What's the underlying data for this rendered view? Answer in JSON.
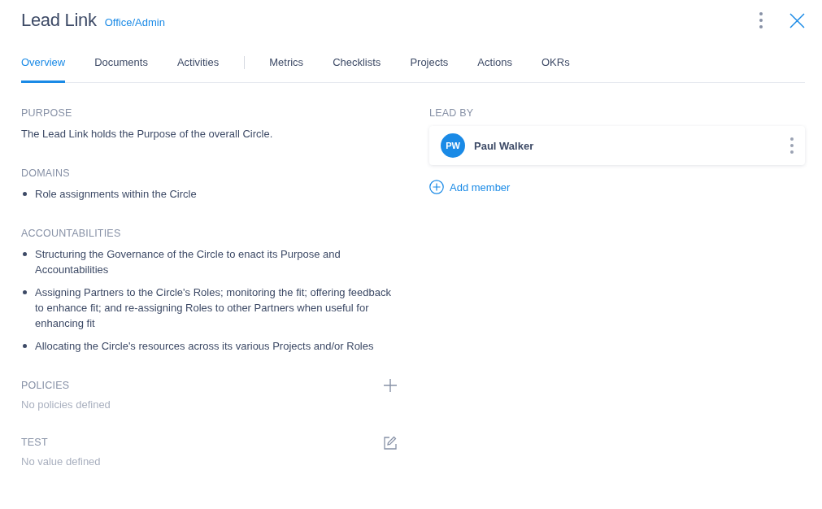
{
  "header": {
    "title": "Lead Link",
    "subtitle": "Office/Admin"
  },
  "tab_groups": [
    {
      "tabs": [
        {
          "label": "Overview",
          "selected": true
        },
        {
          "label": "Documents",
          "selected": false
        },
        {
          "label": "Activities",
          "selected": false
        }
      ]
    },
    {
      "tabs": [
        {
          "label": "Metrics",
          "selected": false
        },
        {
          "label": "Checklists",
          "selected": false
        },
        {
          "label": "Projects",
          "selected": false
        },
        {
          "label": "Actions",
          "selected": false
        },
        {
          "label": "OKRs",
          "selected": false
        }
      ]
    }
  ],
  "sections": [
    {
      "kind": "text",
      "heading": "PURPOSE",
      "text": "The Lead Link holds the Purpose of the overall Circle."
    },
    {
      "kind": "list",
      "heading": "DOMAINS",
      "items": [
        "Role assignments within the Circle"
      ]
    },
    {
      "kind": "list",
      "heading": "ACCOUNTABILITIES",
      "items": [
        "Structuring the Governance of the Circle to enact its Purpose and Accountabilities",
        "Assigning Partners to the Circle's Roles; monitoring the fit; offering feedback to enhance fit; and re-assigning Roles to other Partners when useful for enhancing fit",
        "Allocating the Circle's resources across its various Projects and/or Roles"
      ]
    },
    {
      "kind": "empty",
      "heading": "POLICIES",
      "addable": true,
      "text": "No policies defined"
    },
    {
      "kind": "empty",
      "heading": "TEST",
      "editable": true,
      "text": "No value defined"
    }
  ],
  "lead": {
    "heading": "LEAD BY",
    "members": [
      {
        "initials": "PW",
        "name": "Paul Walker"
      }
    ],
    "add_label": "Add member"
  }
}
